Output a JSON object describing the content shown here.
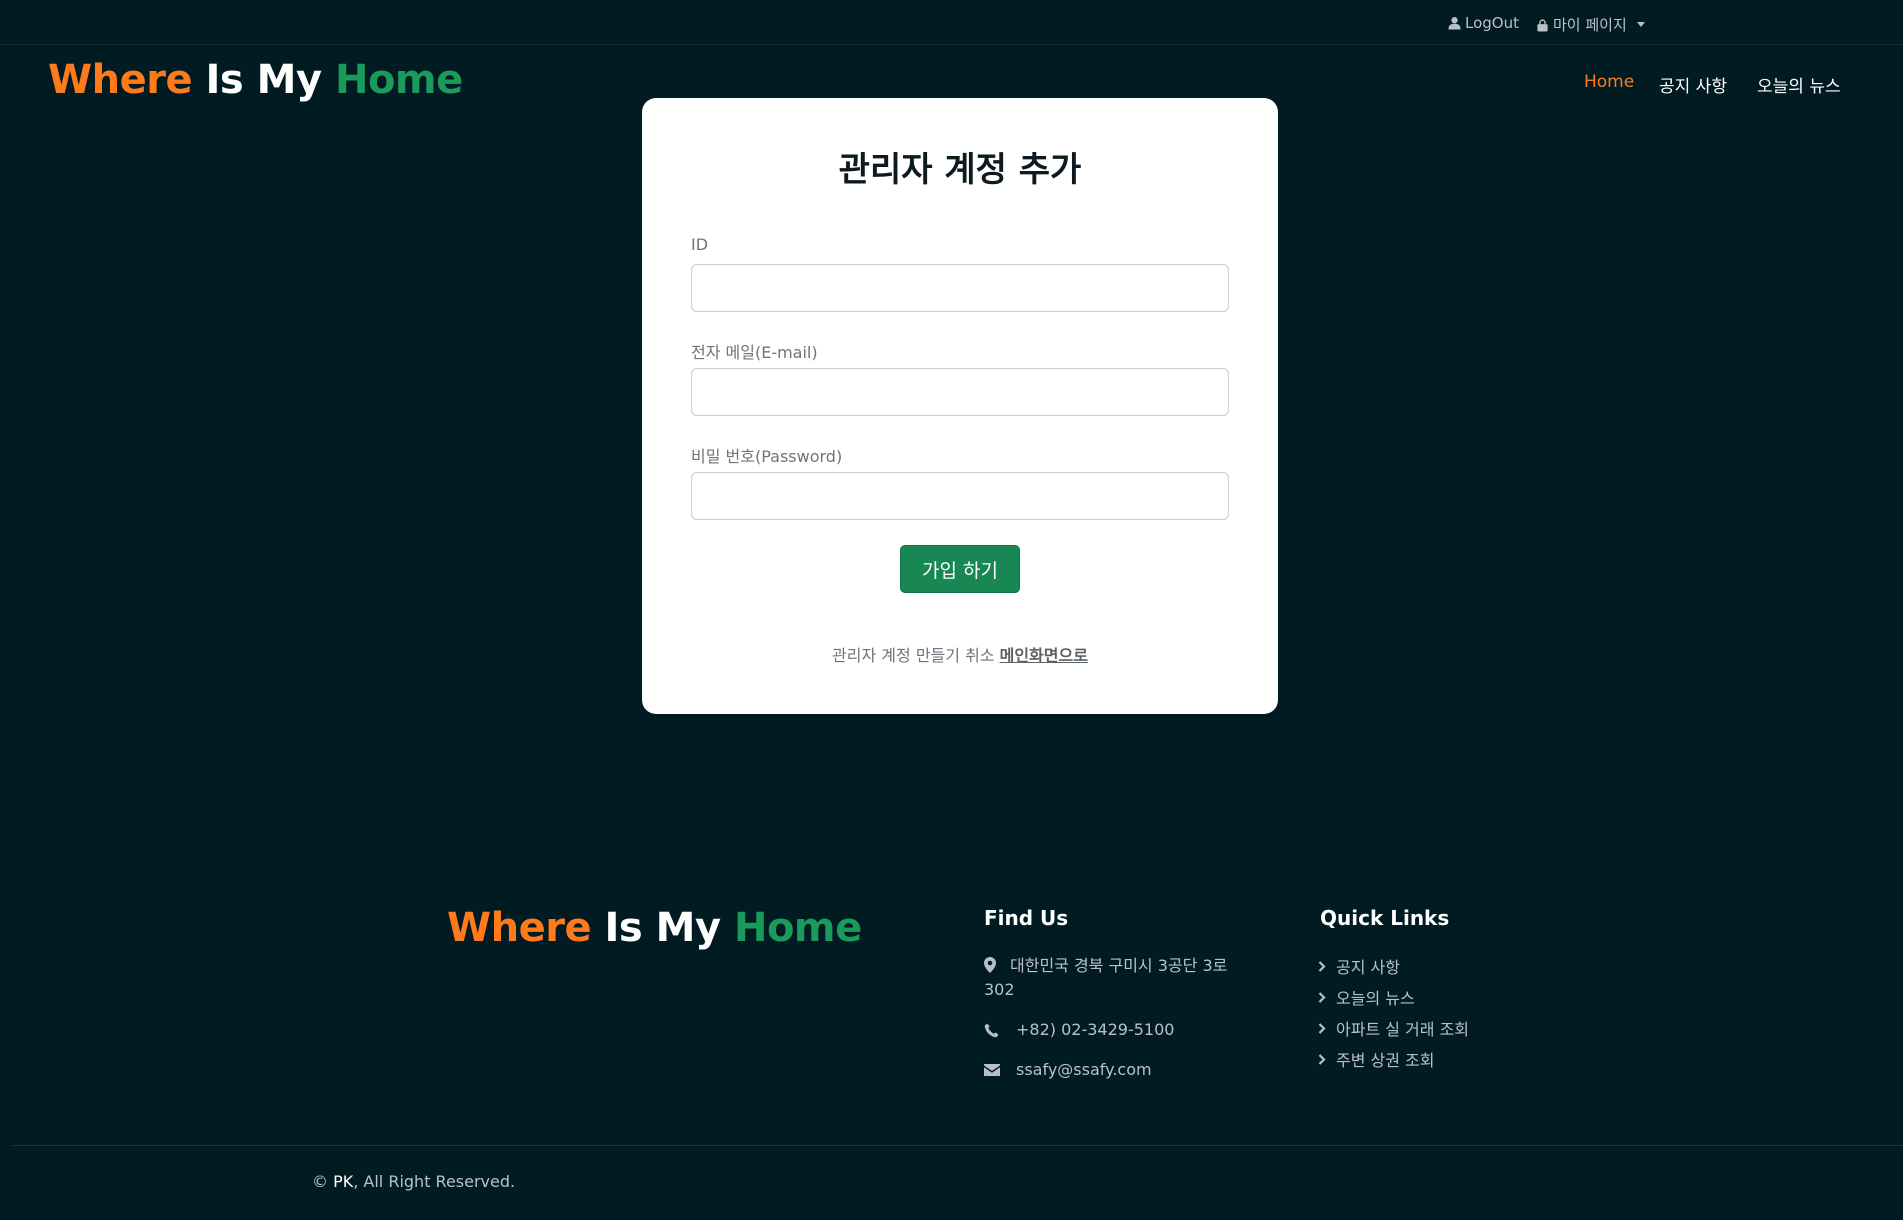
{
  "topbar": {
    "logout_label": "LogOut",
    "mypage_label": "마이 페이지"
  },
  "brand": {
    "part1": "Where",
    "part2": "Is My",
    "part3": "Home"
  },
  "nav": {
    "home": "Home",
    "notice": "공지 사항",
    "news": "오늘의 뉴스"
  },
  "form": {
    "title": "관리자 계정 추가",
    "id_label": "ID",
    "email_label": "전자 메일(E-mail)",
    "password_label": "비밀 번호(Password)",
    "submit_label": "가입 하기",
    "cancel_text": "관리자 계정 만들기 취소",
    "cancel_link": "메인화면으로"
  },
  "footer": {
    "find_us_title": "Find Us",
    "address": "대한민국 경북 구미시 3공단 3로 302",
    "phone": "+82) 02-3429-5100",
    "email": "ssafy@ssafy.com",
    "quick_links_title": "Quick Links",
    "quick_links": [
      "공지 사항",
      "오늘의 뉴스",
      "아파트 실 거래 조회",
      "주변 상권 조회"
    ],
    "copyright_symbol": "©",
    "copyright_owner": "PK",
    "copyright_rest": ", All Right Reserved."
  },
  "colors": {
    "background": "#011b23",
    "brand_orange": "#ff7a1a",
    "brand_green": "#1a9b5b",
    "button_green": "#198754"
  }
}
